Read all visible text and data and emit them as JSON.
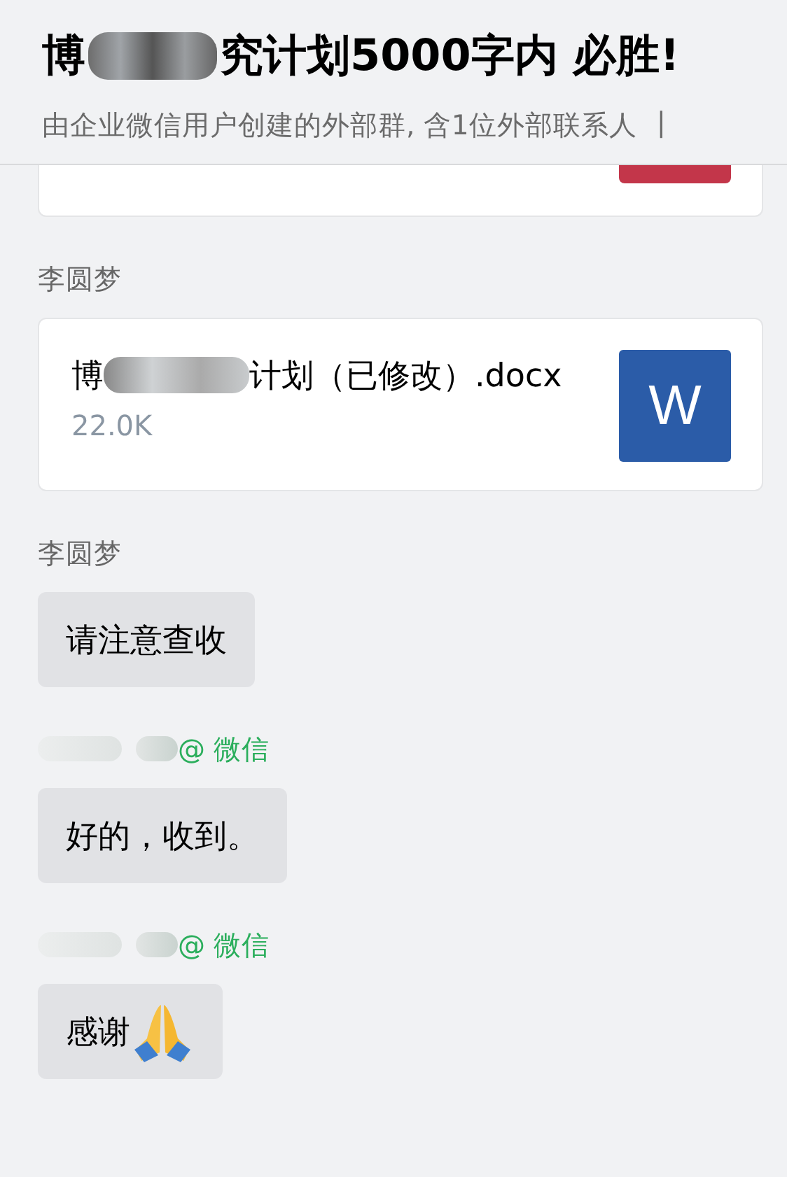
{
  "header": {
    "title_parts": [
      "博",
      "究计划5000字内 必胜!"
    ],
    "subtitle": "由企业微信用户创建的外部群, 含1位外部联系人",
    "separator": "|"
  },
  "messages": [
    {
      "kind": "partial_card"
    },
    {
      "kind": "file",
      "sender": {
        "name": "李圆梦"
      },
      "file_name_parts": [
        "博",
        "计划（已修改）.docx"
      ],
      "size": "22.0K",
      "icon_text": "W"
    },
    {
      "kind": "text",
      "sender": {
        "name": "李圆梦"
      },
      "text": "请注意查收"
    },
    {
      "kind": "text",
      "sender": {
        "via": "@ 微信"
      },
      "text": "好的，收到。"
    },
    {
      "kind": "text",
      "sender": {
        "via": "@ 微信"
      },
      "text": "感谢",
      "praying_hands_icon": true
    }
  ]
}
